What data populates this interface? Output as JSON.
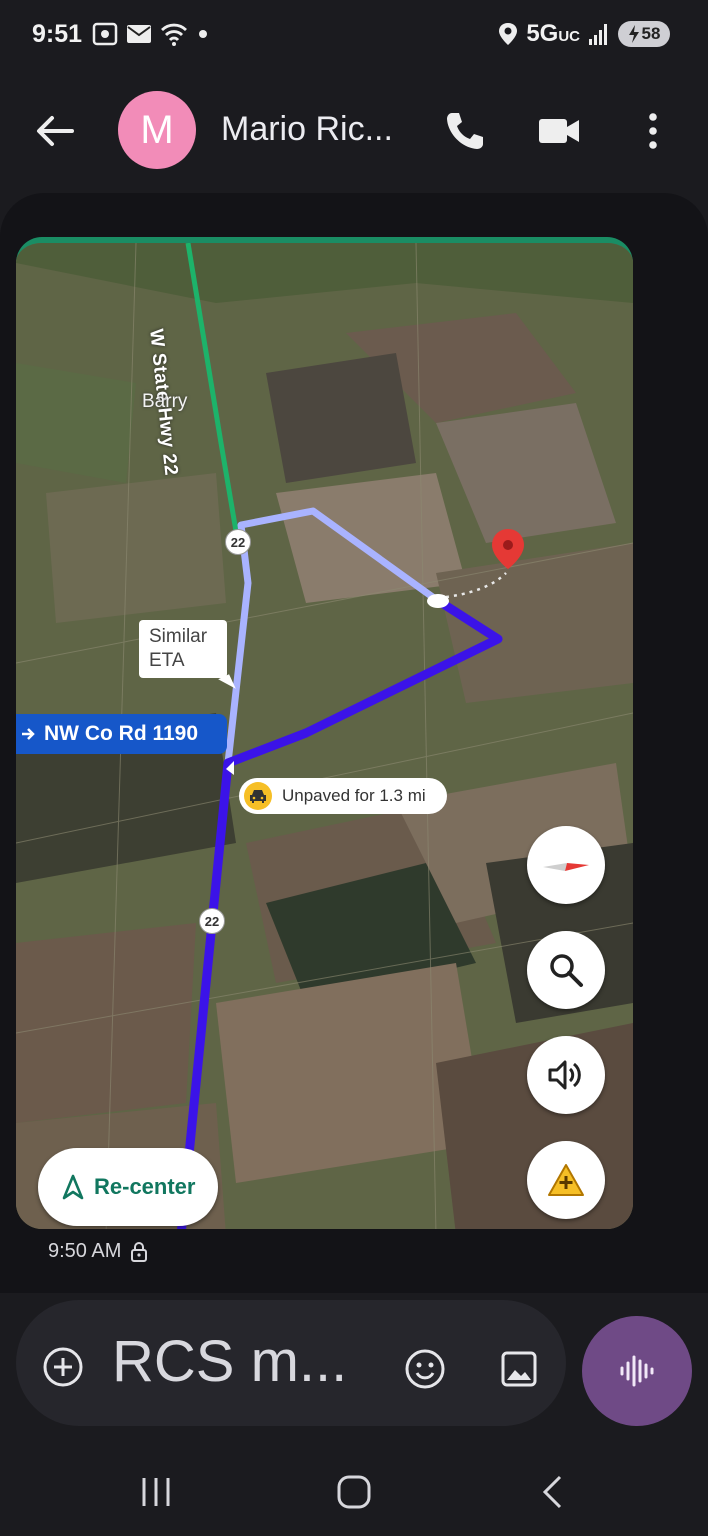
{
  "status_bar": {
    "time": "9:51",
    "network": "5G",
    "network_sub": "UC",
    "battery": "58"
  },
  "header": {
    "avatar_letter": "M",
    "contact_name": "Mario Ric...",
    "avatar_color": "#f28cb8"
  },
  "map": {
    "highway_name": "W State Hwy 22",
    "place_name": "Barry",
    "similar_eta": "Similar ETA",
    "street_name": "NW Co Rd 1190",
    "unpaved_text": "Unpaved for 1.3 mi",
    "shield_1": "22",
    "shield_2": "22",
    "shield_3": "22",
    "recenter_label": "Re-center",
    "route_color": "#3b13e8",
    "alt_route_color": "#a9b3ff"
  },
  "message": {
    "timestamp": "9:50 AM"
  },
  "compose": {
    "placeholder": "RCS m..."
  }
}
